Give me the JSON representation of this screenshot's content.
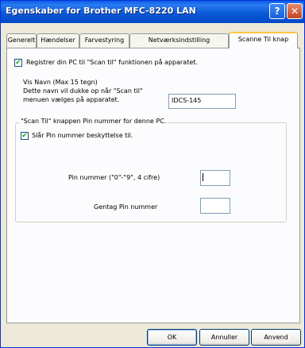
{
  "window": {
    "title": "Egenskaber for Brother MFC-8220 LAN",
    "help_symbol": "?",
    "close_symbol": "✕"
  },
  "tabs": [
    "Generelt",
    "Hændelser",
    "Farvestyring",
    "Netværksindstilling",
    "Scanne Til knap"
  ],
  "scan_to": {
    "register_checkbox": {
      "label": "Registrer din PC til \"Scan til\" funktionen på apparatet.",
      "checked": true
    },
    "name_label": "Vis Navn (Max 15 tegn)",
    "name_desc_1": "Dette navn vil dukke op når \"Scan til\"",
    "name_desc_2": "menuen vælges på apparatet.",
    "name_value": "IDCS-145",
    "pin_group": {
      "legend": "\"Scan Til\" knappen Pin nummer for denne PC.",
      "protect_checkbox": {
        "label": "Slår Pin nummer beskyttelse til.",
        "checked": true
      },
      "pin_label": "Pin nummer (\"0\"-\"9\", 4 cifre)",
      "pin_value": "",
      "repeat_label": "Gentag Pin nummer",
      "repeat_value": ""
    }
  },
  "buttons": {
    "ok": "OK",
    "cancel": "Annuller",
    "apply": "Anvend"
  },
  "icons": {
    "check": "✔"
  }
}
